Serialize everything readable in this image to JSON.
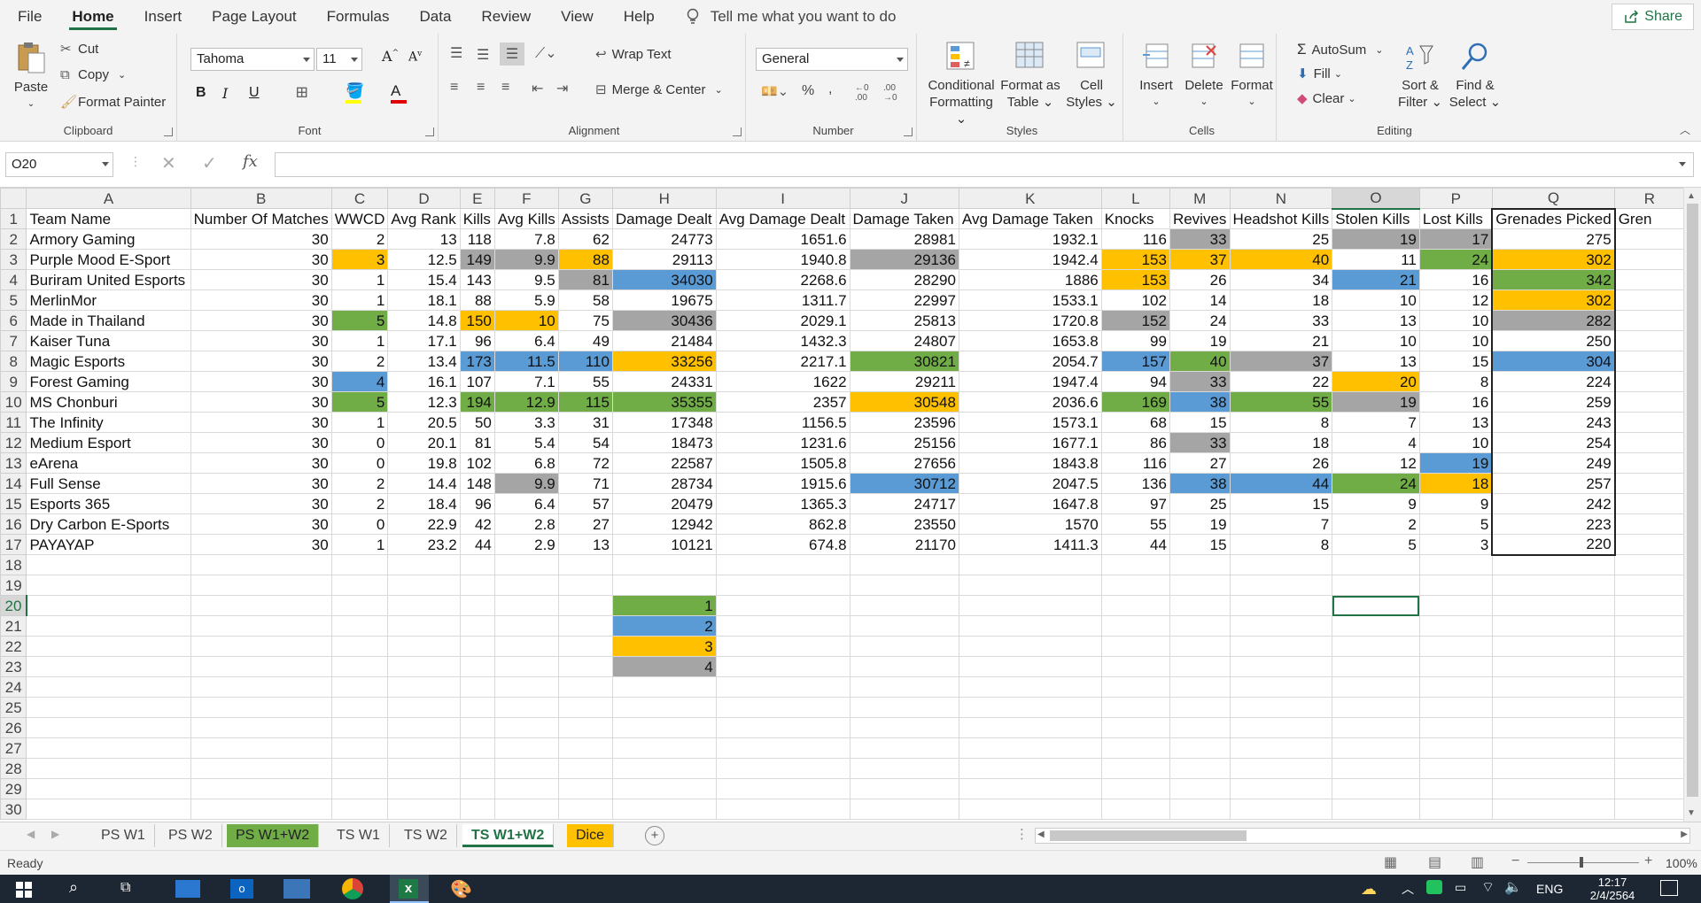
{
  "menu": {
    "tabs": [
      "File",
      "Home",
      "Insert",
      "Page Layout",
      "Formulas",
      "Data",
      "Review",
      "View",
      "Help"
    ],
    "active": "Home",
    "tellme": "Tell me what you want to do",
    "share": "Share"
  },
  "ribbon": {
    "clipboard": {
      "paste": "Paste",
      "cut": "Cut",
      "copy": "Copy",
      "painter": "Format Painter",
      "label": "Clipboard"
    },
    "font": {
      "name": "Tahoma",
      "size": "11",
      "label": "Font"
    },
    "alignment": {
      "wrap": "Wrap Text",
      "merge": "Merge & Center",
      "label": "Alignment"
    },
    "number": {
      "format": "General",
      "label": "Number"
    },
    "styles": {
      "cond1": "Conditional",
      "cond2": "Formatting",
      "table1": "Format as",
      "table2": "Table",
      "cell1": "Cell",
      "cell2": "Styles",
      "label": "Styles"
    },
    "cells": {
      "insert": "Insert",
      "delete": "Delete",
      "format": "Format",
      "label": "Cells"
    },
    "editing": {
      "autosum": "AutoSum",
      "fill": "Fill",
      "clear": "Clear",
      "sort1": "Sort &",
      "sort2": "Filter",
      "find1": "Find &",
      "find2": "Select",
      "label": "Editing"
    }
  },
  "formula_bar": {
    "name_box": "O20",
    "formula": ""
  },
  "columns": [
    "A",
    "B",
    "C",
    "D",
    "E",
    "F",
    "G",
    "H",
    "I",
    "J",
    "K",
    "L",
    "M",
    "N",
    "O",
    "P",
    "Q",
    "R"
  ],
  "selected_column": "O",
  "selected_row": "20",
  "headers": [
    "Team Name",
    "Number Of Matches",
    "WWCD",
    "Avg Rank",
    "Kills",
    "Avg Kills",
    "Assists",
    "Damage Dealt",
    "Avg Damage Dealt",
    "Damage Taken",
    "Avg Damage Taken",
    "Knocks",
    "Revives",
    "Headshot Kills",
    "Stolen Kills",
    "Lost Kills",
    "Grenades Picked",
    "Gren"
  ],
  "rows": [
    [
      [
        "Armory Gaming",
        ""
      ],
      [
        "30",
        ""
      ],
      [
        "2",
        ""
      ],
      [
        "13",
        ""
      ],
      [
        "118",
        ""
      ],
      [
        "7.8",
        ""
      ],
      [
        "62",
        ""
      ],
      [
        "24773",
        ""
      ],
      [
        "1651.6",
        ""
      ],
      [
        "28981",
        ""
      ],
      [
        "1932.1",
        ""
      ],
      [
        "116",
        ""
      ],
      [
        "33",
        "R"
      ],
      [
        "25",
        ""
      ],
      [
        "19",
        "R"
      ],
      [
        "17",
        "R"
      ],
      [
        "275",
        ""
      ],
      [
        "",
        ""
      ]
    ],
    [
      [
        "Purple Mood E-Sport",
        ""
      ],
      [
        "30",
        ""
      ],
      [
        "3",
        "Y"
      ],
      [
        "12.5",
        ""
      ],
      [
        "149",
        "R"
      ],
      [
        "9.9",
        "R"
      ],
      [
        "88",
        "Y"
      ],
      [
        "29113",
        ""
      ],
      [
        "1940.8",
        ""
      ],
      [
        "29136",
        "R"
      ],
      [
        "1942.4",
        ""
      ],
      [
        "153",
        "Y"
      ],
      [
        "37",
        "Y"
      ],
      [
        "40",
        "Y"
      ],
      [
        "11",
        ""
      ],
      [
        "24",
        "G"
      ],
      [
        "302",
        "Y"
      ],
      [
        "",
        ""
      ]
    ],
    [
      [
        "Buriram United Esports",
        ""
      ],
      [
        "30",
        ""
      ],
      [
        "1",
        ""
      ],
      [
        "15.4",
        ""
      ],
      [
        "143",
        ""
      ],
      [
        "9.5",
        ""
      ],
      [
        "81",
        "R"
      ],
      [
        "34030",
        "B"
      ],
      [
        "2268.6",
        ""
      ],
      [
        "28290",
        ""
      ],
      [
        "1886",
        ""
      ],
      [
        "153",
        "Y"
      ],
      [
        "26",
        ""
      ],
      [
        "34",
        ""
      ],
      [
        "21",
        "B"
      ],
      [
        "16",
        ""
      ],
      [
        "342",
        "G"
      ],
      [
        "",
        ""
      ]
    ],
    [
      [
        "MerlinMor",
        ""
      ],
      [
        "30",
        ""
      ],
      [
        "1",
        ""
      ],
      [
        "18.1",
        ""
      ],
      [
        "88",
        ""
      ],
      [
        "5.9",
        ""
      ],
      [
        "58",
        ""
      ],
      [
        "19675",
        ""
      ],
      [
        "1311.7",
        ""
      ],
      [
        "22997",
        ""
      ],
      [
        "1533.1",
        ""
      ],
      [
        "102",
        ""
      ],
      [
        "14",
        ""
      ],
      [
        "18",
        ""
      ],
      [
        "10",
        ""
      ],
      [
        "12",
        ""
      ],
      [
        "302",
        "Y"
      ],
      [
        "",
        ""
      ]
    ],
    [
      [
        "Made in Thailand",
        ""
      ],
      [
        "30",
        ""
      ],
      [
        "5",
        "G"
      ],
      [
        "14.8",
        ""
      ],
      [
        "150",
        "Y"
      ],
      [
        "10",
        "Y"
      ],
      [
        "75",
        ""
      ],
      [
        "30436",
        "R"
      ],
      [
        "2029.1",
        ""
      ],
      [
        "25813",
        ""
      ],
      [
        "1720.8",
        ""
      ],
      [
        "152",
        "R"
      ],
      [
        "24",
        ""
      ],
      [
        "33",
        ""
      ],
      [
        "13",
        ""
      ],
      [
        "10",
        ""
      ],
      [
        "282",
        "R"
      ],
      [
        "",
        ""
      ]
    ],
    [
      [
        "Kaiser Tuna",
        ""
      ],
      [
        "30",
        ""
      ],
      [
        "1",
        ""
      ],
      [
        "17.1",
        ""
      ],
      [
        "96",
        ""
      ],
      [
        "6.4",
        ""
      ],
      [
        "49",
        ""
      ],
      [
        "21484",
        ""
      ],
      [
        "1432.3",
        ""
      ],
      [
        "24807",
        ""
      ],
      [
        "1653.8",
        ""
      ],
      [
        "99",
        ""
      ],
      [
        "19",
        ""
      ],
      [
        "21",
        ""
      ],
      [
        "10",
        ""
      ],
      [
        "10",
        ""
      ],
      [
        "250",
        ""
      ],
      [
        "",
        ""
      ]
    ],
    [
      [
        "Magic Esports",
        ""
      ],
      [
        "30",
        ""
      ],
      [
        "2",
        ""
      ],
      [
        "13.4",
        ""
      ],
      [
        "173",
        "B"
      ],
      [
        "11.5",
        "B"
      ],
      [
        "110",
        "B"
      ],
      [
        "33256",
        "Y"
      ],
      [
        "2217.1",
        ""
      ],
      [
        "30821",
        "G"
      ],
      [
        "2054.7",
        ""
      ],
      [
        "157",
        "B"
      ],
      [
        "40",
        "G"
      ],
      [
        "37",
        "R"
      ],
      [
        "13",
        ""
      ],
      [
        "15",
        ""
      ],
      [
        "304",
        "B"
      ],
      [
        "",
        ""
      ]
    ],
    [
      [
        "Forest Gaming",
        ""
      ],
      [
        "30",
        ""
      ],
      [
        "4",
        "B"
      ],
      [
        "16.1",
        ""
      ],
      [
        "107",
        ""
      ],
      [
        "7.1",
        ""
      ],
      [
        "55",
        ""
      ],
      [
        "24331",
        ""
      ],
      [
        "1622",
        ""
      ],
      [
        "29211",
        ""
      ],
      [
        "1947.4",
        ""
      ],
      [
        "94",
        ""
      ],
      [
        "33",
        "R"
      ],
      [
        "22",
        ""
      ],
      [
        "20",
        "Y"
      ],
      [
        "8",
        ""
      ],
      [
        "224",
        ""
      ],
      [
        "",
        ""
      ]
    ],
    [
      [
        "MS Chonburi",
        ""
      ],
      [
        "30",
        ""
      ],
      [
        "5",
        "G"
      ],
      [
        "12.3",
        ""
      ],
      [
        "194",
        "G"
      ],
      [
        "12.9",
        "G"
      ],
      [
        "115",
        "G"
      ],
      [
        "35355",
        "G"
      ],
      [
        "2357",
        ""
      ],
      [
        "30548",
        "Y"
      ],
      [
        "2036.6",
        ""
      ],
      [
        "169",
        "G"
      ],
      [
        "38",
        "B"
      ],
      [
        "55",
        "G"
      ],
      [
        "19",
        "R"
      ],
      [
        "16",
        ""
      ],
      [
        "259",
        ""
      ],
      [
        "",
        ""
      ]
    ],
    [
      [
        "The Infinity",
        ""
      ],
      [
        "30",
        ""
      ],
      [
        "1",
        ""
      ],
      [
        "20.5",
        ""
      ],
      [
        "50",
        ""
      ],
      [
        "3.3",
        ""
      ],
      [
        "31",
        ""
      ],
      [
        "17348",
        ""
      ],
      [
        "1156.5",
        ""
      ],
      [
        "23596",
        ""
      ],
      [
        "1573.1",
        ""
      ],
      [
        "68",
        ""
      ],
      [
        "15",
        ""
      ],
      [
        "8",
        ""
      ],
      [
        "7",
        ""
      ],
      [
        "13",
        ""
      ],
      [
        "243",
        ""
      ],
      [
        "",
        ""
      ]
    ],
    [
      [
        "Medium Esport",
        ""
      ],
      [
        "30",
        ""
      ],
      [
        "0",
        ""
      ],
      [
        "20.1",
        ""
      ],
      [
        "81",
        ""
      ],
      [
        "5.4",
        ""
      ],
      [
        "54",
        ""
      ],
      [
        "18473",
        ""
      ],
      [
        "1231.6",
        ""
      ],
      [
        "25156",
        ""
      ],
      [
        "1677.1",
        ""
      ],
      [
        "86",
        ""
      ],
      [
        "33",
        "R"
      ],
      [
        "18",
        ""
      ],
      [
        "4",
        ""
      ],
      [
        "10",
        ""
      ],
      [
        "254",
        ""
      ],
      [
        "",
        ""
      ]
    ],
    [
      [
        "eArena",
        ""
      ],
      [
        "30",
        ""
      ],
      [
        "0",
        ""
      ],
      [
        "19.8",
        ""
      ],
      [
        "102",
        ""
      ],
      [
        "6.8",
        ""
      ],
      [
        "72",
        ""
      ],
      [
        "22587",
        ""
      ],
      [
        "1505.8",
        ""
      ],
      [
        "27656",
        ""
      ],
      [
        "1843.8",
        ""
      ],
      [
        "116",
        ""
      ],
      [
        "27",
        ""
      ],
      [
        "26",
        ""
      ],
      [
        "12",
        ""
      ],
      [
        "19",
        "B"
      ],
      [
        "249",
        ""
      ],
      [
        "",
        ""
      ]
    ],
    [
      [
        "Full Sense",
        ""
      ],
      [
        "30",
        ""
      ],
      [
        "2",
        ""
      ],
      [
        "14.4",
        ""
      ],
      [
        "148",
        ""
      ],
      [
        "9.9",
        "R"
      ],
      [
        "71",
        ""
      ],
      [
        "28734",
        ""
      ],
      [
        "1915.6",
        ""
      ],
      [
        "30712",
        "B"
      ],
      [
        "2047.5",
        ""
      ],
      [
        "136",
        ""
      ],
      [
        "38",
        "B"
      ],
      [
        "44",
        "B"
      ],
      [
        "24",
        "G"
      ],
      [
        "18",
        "Y"
      ],
      [
        "257",
        ""
      ],
      [
        "",
        ""
      ]
    ],
    [
      [
        "Esports 365",
        ""
      ],
      [
        "30",
        ""
      ],
      [
        "2",
        ""
      ],
      [
        "18.4",
        ""
      ],
      [
        "96",
        ""
      ],
      [
        "6.4",
        ""
      ],
      [
        "57",
        ""
      ],
      [
        "20479",
        ""
      ],
      [
        "1365.3",
        ""
      ],
      [
        "24717",
        ""
      ],
      [
        "1647.8",
        ""
      ],
      [
        "97",
        ""
      ],
      [
        "25",
        ""
      ],
      [
        "15",
        ""
      ],
      [
        "9",
        ""
      ],
      [
        "9",
        ""
      ],
      [
        "242",
        ""
      ],
      [
        "",
        ""
      ]
    ],
    [
      [
        "Dry Carbon E-Sports",
        ""
      ],
      [
        "30",
        ""
      ],
      [
        "0",
        ""
      ],
      [
        "22.9",
        ""
      ],
      [
        "42",
        ""
      ],
      [
        "2.8",
        ""
      ],
      [
        "27",
        ""
      ],
      [
        "12942",
        ""
      ],
      [
        "862.8",
        ""
      ],
      [
        "23550",
        ""
      ],
      [
        "1570",
        ""
      ],
      [
        "55",
        ""
      ],
      [
        "19",
        ""
      ],
      [
        "7",
        ""
      ],
      [
        "2",
        ""
      ],
      [
        "5",
        ""
      ],
      [
        "223",
        ""
      ],
      [
        "",
        ""
      ]
    ],
    [
      [
        "PAYAYAP",
        ""
      ],
      [
        "30",
        ""
      ],
      [
        "1",
        ""
      ],
      [
        "23.2",
        ""
      ],
      [
        "44",
        ""
      ],
      [
        "2.9",
        ""
      ],
      [
        "13",
        ""
      ],
      [
        "10121",
        ""
      ],
      [
        "674.8",
        ""
      ],
      [
        "21170",
        ""
      ],
      [
        "1411.3",
        ""
      ],
      [
        "44",
        ""
      ],
      [
        "15",
        ""
      ],
      [
        "8",
        ""
      ],
      [
        "5",
        ""
      ],
      [
        "3",
        ""
      ],
      [
        "220",
        ""
      ],
      [
        "",
        ""
      ]
    ]
  ],
  "legend": [
    [
      "1",
      "G"
    ],
    [
      "2",
      "B"
    ],
    [
      "3",
      "Y"
    ],
    [
      "4",
      "R"
    ]
  ],
  "sheet_tabs": [
    {
      "label": "PS W1",
      "style": ""
    },
    {
      "label": "PS W2",
      "style": ""
    },
    {
      "label": "PS W1+W2",
      "style": "green"
    },
    {
      "label": "TS W1",
      "style": ""
    },
    {
      "label": "TS W2",
      "style": ""
    },
    {
      "label": "TS W1+W2",
      "style": "active"
    },
    {
      "label": "Dice",
      "style": "yellow"
    }
  ],
  "status": {
    "ready": "Ready",
    "zoom": "100%"
  },
  "taskbar": {
    "lang": "ENG",
    "time": "12:17",
    "date": "2/4/2564"
  },
  "colors": {
    "G": "#70ad47",
    "B": "#5b9bd5",
    "Y": "#ffc000",
    "R": "#a5a5a5",
    "accent": "#217346"
  }
}
